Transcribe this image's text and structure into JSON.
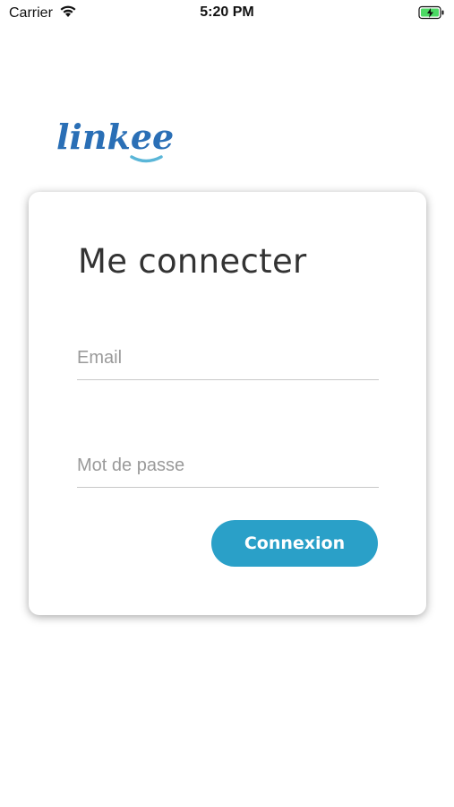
{
  "status_bar": {
    "carrier": "Carrier",
    "time": "5:20 PM",
    "icons": [
      "wifi-icon",
      "battery-charging-icon"
    ]
  },
  "logo": {
    "text": "linkee",
    "color": "#2a6fb6",
    "accent": "#5ab6d8"
  },
  "login": {
    "title": "Me connecter",
    "email_placeholder": "Email",
    "email_value": "",
    "password_placeholder": "Mot de passe",
    "password_value": "",
    "submit_label": "Connexion"
  },
  "colors": {
    "primary_button": "#2aa0c8",
    "title_text": "#333333",
    "placeholder": "#9a9a9a",
    "battery_charge": "#4cd964"
  }
}
